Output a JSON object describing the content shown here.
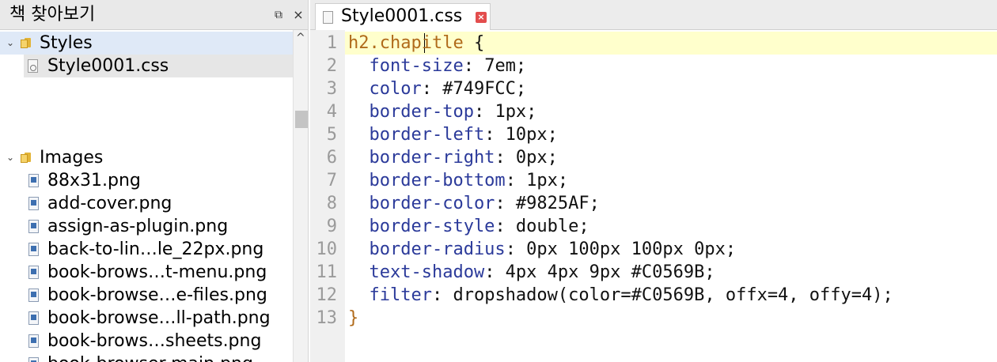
{
  "browser": {
    "title": "책 찾아보기",
    "float_button": "⧉",
    "close_button": "×",
    "items": [
      {
        "kind": "folder",
        "label": "Styles",
        "expander": "⌄"
      },
      {
        "kind": "css",
        "label": "Style0001.css"
      },
      {
        "kind": "folder",
        "label": "Images",
        "expander": "⌄"
      },
      {
        "kind": "image",
        "label": "88x31.png"
      },
      {
        "kind": "image",
        "label": "add-cover.png"
      },
      {
        "kind": "image",
        "label": "assign-as-plugin.png"
      },
      {
        "kind": "image",
        "label": "back-to-lin…le_22px.png"
      },
      {
        "kind": "image",
        "label": "book-brows…t-menu.png"
      },
      {
        "kind": "image",
        "label": "book-browse…e-files.png"
      },
      {
        "kind": "image",
        "label": "book-browse…ll-path.png"
      },
      {
        "kind": "image",
        "label": "book-brows…sheets.png"
      },
      {
        "kind": "image",
        "label": "book-browser-main.png"
      }
    ],
    "scroll_up": "^"
  },
  "editor": {
    "tab_label": "Style0001.css",
    "tab_close": "×",
    "lines": [
      {
        "num": "1",
        "parts": [
          {
            "c": "sel",
            "t": "h2.chapitle"
          },
          {
            "c": "val",
            "t": " {"
          }
        ]
      },
      {
        "num": "2",
        "parts": [
          {
            "c": "prop",
            "t": "  font-size"
          },
          {
            "c": "val",
            "t": ": 7em;"
          }
        ]
      },
      {
        "num": "3",
        "parts": [
          {
            "c": "prop",
            "t": "  color"
          },
          {
            "c": "val",
            "t": ": #749FCC;"
          }
        ]
      },
      {
        "num": "4",
        "parts": [
          {
            "c": "prop",
            "t": "  border-top"
          },
          {
            "c": "val",
            "t": ": 1px;"
          }
        ]
      },
      {
        "num": "5",
        "parts": [
          {
            "c": "prop",
            "t": "  border-left"
          },
          {
            "c": "val",
            "t": ": 10px;"
          }
        ]
      },
      {
        "num": "6",
        "parts": [
          {
            "c": "prop",
            "t": "  border-right"
          },
          {
            "c": "val",
            "t": ": 0px;"
          }
        ]
      },
      {
        "num": "7",
        "parts": [
          {
            "c": "prop",
            "t": "  border-bottom"
          },
          {
            "c": "val",
            "t": ": 1px;"
          }
        ]
      },
      {
        "num": "8",
        "parts": [
          {
            "c": "prop",
            "t": "  border-color"
          },
          {
            "c": "val",
            "t": ": #9825AF;"
          }
        ]
      },
      {
        "num": "9",
        "parts": [
          {
            "c": "prop",
            "t": "  border-style"
          },
          {
            "c": "val",
            "t": ": double;"
          }
        ]
      },
      {
        "num": "10",
        "parts": [
          {
            "c": "prop",
            "t": "  border-radius"
          },
          {
            "c": "val",
            "t": ": 0px 100px 100px 0px;"
          }
        ]
      },
      {
        "num": "11",
        "parts": [
          {
            "c": "prop",
            "t": "  text-shadow"
          },
          {
            "c": "val",
            "t": ": 4px 4px 9px #C0569B;"
          }
        ]
      },
      {
        "num": "12",
        "parts": [
          {
            "c": "prop",
            "t": "  filter"
          },
          {
            "c": "val",
            "t": ": dropshadow(color=#C0569B, offx=4, offy=4);"
          }
        ]
      },
      {
        "num": "13",
        "parts": [
          {
            "c": "sel",
            "t": "}"
          }
        ]
      }
    ]
  }
}
